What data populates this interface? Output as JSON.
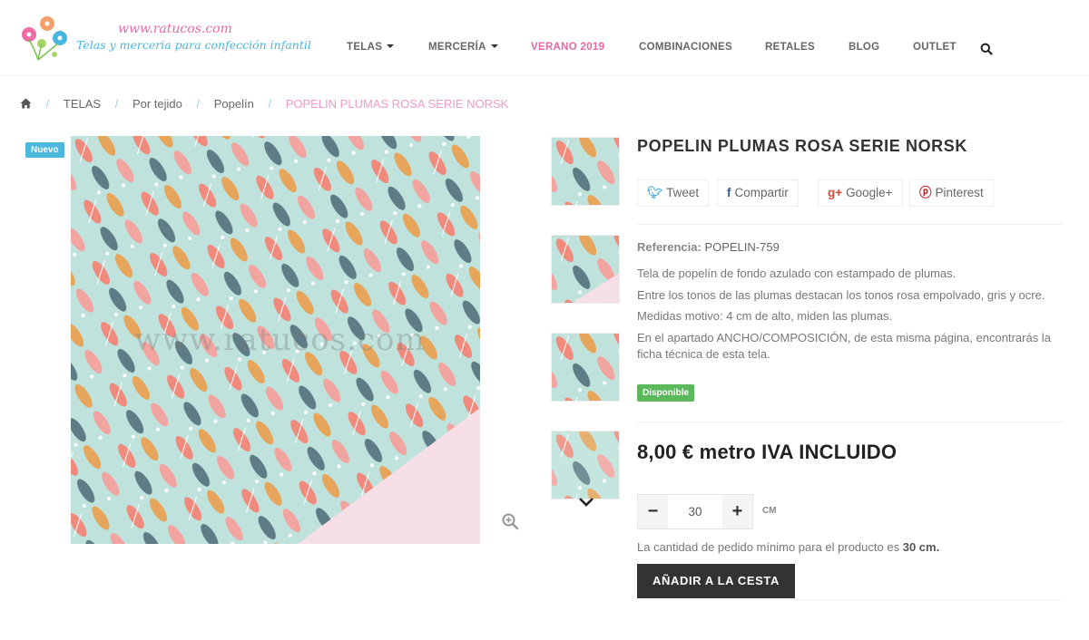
{
  "brand": {
    "url": "www.ratucos.com",
    "tagline": "Telas y merceria para confección infantil",
    "colors": {
      "pink": "#e56aa6",
      "blue": "#47b6e0",
      "dark": "#333333",
      "green": "#5cb85c"
    }
  },
  "nav": {
    "items": [
      {
        "label": "TELAS",
        "dropdown": true
      },
      {
        "label": "MERCERÍA",
        "dropdown": true
      },
      {
        "label": "VERANO 2019",
        "dropdown": false,
        "highlight": true
      },
      {
        "label": "COMBINACIONES",
        "dropdown": false
      },
      {
        "label": "RETALES",
        "dropdown": false
      },
      {
        "label": "BLOG",
        "dropdown": false
      },
      {
        "label": "OUTLET",
        "dropdown": false
      }
    ],
    "search_icon": "search-icon"
  },
  "breadcrumb": {
    "home_icon": "home-icon",
    "sep": "/",
    "items": [
      "TELAS",
      "Por tejido",
      "Popelín"
    ],
    "current": "POPELIN PLUMAS ROSA SERIE NORSK"
  },
  "gallery": {
    "badge": "Nuevo",
    "watermark": "www.ratucos.com",
    "zoom_icon": "zoom-in-icon",
    "thumbnail_count": 4,
    "more_icon": "chevron-down-icon"
  },
  "product": {
    "title": "POPELIN PLUMAS ROSA SERIE NORSK",
    "share": [
      {
        "label": "Tweet",
        "icon": "twitter-icon"
      },
      {
        "label": "Compartir",
        "icon": "facebook-icon"
      },
      {
        "label": "Google+",
        "icon": "google-plus-icon"
      },
      {
        "label": "Pinterest",
        "icon": "pinterest-icon"
      }
    ],
    "reference_label": "Referencia:",
    "reference_value": "POPELIN-759",
    "description": [
      "Tela de popelín de fondo azulado con estampado de plumas.",
      "Entre los tonos de las plumas destacan los tonos rosa empolvado, gris y ocre.",
      "Medidas motivo: 4 cm de alto, miden las plumas.",
      "En el apartado ANCHO/COMPOSICIÓN, de esta misma página, encontrarás la ficha técnica de esta tela."
    ],
    "availability": "Disponible",
    "price": "8,00 € metro IVA INCLUIDO",
    "quantity": "30",
    "quantity_unit": "CM",
    "min_qty_text": "La cantidad de pedido mínimo para el producto es",
    "min_qty_value": "30 cm.",
    "add_to_cart": "AÑADIR A LA CESTA"
  }
}
